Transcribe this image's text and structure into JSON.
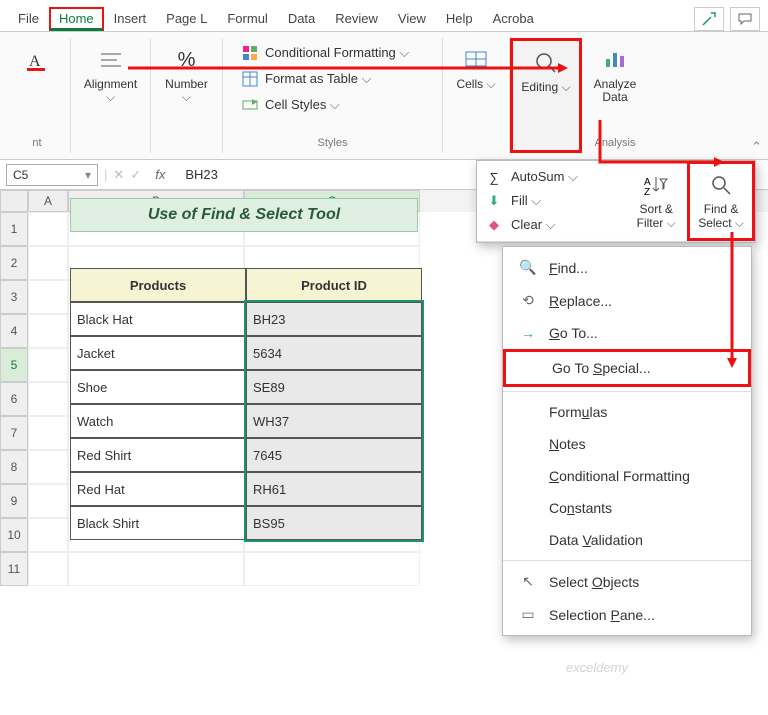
{
  "tabs": {
    "file": "File",
    "home": "Home",
    "insert": "Insert",
    "pagelayout": "Page L",
    "formulas": "Formul",
    "data": "Data",
    "review": "Review",
    "view": "View",
    "help": "Help",
    "acrobat": "Acroba"
  },
  "ribbon": {
    "font_group": "nt",
    "alignment": "Alignment",
    "number": "Number",
    "styles": {
      "label": "Styles",
      "cond_format": "Conditional Formatting",
      "format_table": "Format as Table",
      "cell_styles": "Cell Styles"
    },
    "cells": "Cells",
    "editing": "Editing",
    "analyze": "Analyze\nData",
    "analysis": "Analysis"
  },
  "fx": {
    "name": "C5",
    "label": "fx",
    "value": "BH23"
  },
  "cols": {
    "A": "A",
    "B": "B",
    "C": "C"
  },
  "rows": [
    "1",
    "2",
    "3",
    "4",
    "5",
    "6",
    "7",
    "8",
    "9",
    "10",
    "11"
  ],
  "tabletitle": "Use of Find & Select Tool",
  "headers": {
    "products": "Products",
    "pid": "Product ID"
  },
  "data_rows": [
    {
      "product": "Black Hat",
      "pid": "BH23"
    },
    {
      "product": "Jacket",
      "pid": "5634"
    },
    {
      "product": "Shoe",
      "pid": "SE89"
    },
    {
      "product": "Watch",
      "pid": "WH37"
    },
    {
      "product": "Red Shirt",
      "pid": "7645"
    },
    {
      "product": "Red Hat",
      "pid": "RH61"
    },
    {
      "product": "Black Shirt",
      "pid": "BS95"
    }
  ],
  "edit_panel": {
    "autosum": "AutoSum",
    "fill": "Fill",
    "clear": "Clear",
    "sortfilter": "Sort &\nFilter",
    "findselect": "Find &\nSelect"
  },
  "menu": {
    "find": "Find...",
    "replace": "Replace...",
    "goto": "Go To...",
    "gotospecial": "Go To Special...",
    "formulas": "Formulas",
    "notes": "Notes",
    "condformat": "Conditional Formatting",
    "constants": "Constants",
    "datavalid": "Data Validation",
    "selectobj": "Select Objects",
    "selpane": "Selection Pane..."
  },
  "watermark": "exceldemy"
}
